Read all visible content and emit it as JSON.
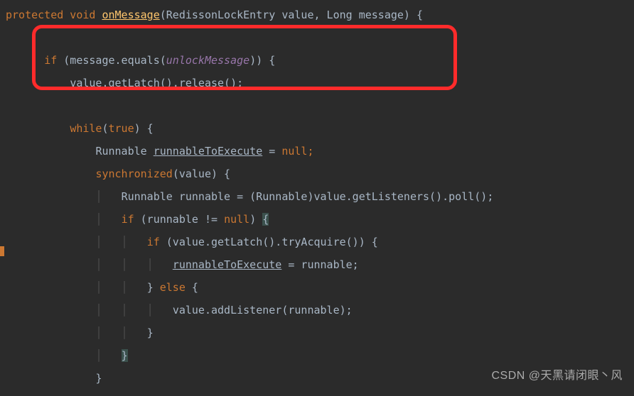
{
  "code": {
    "sig_mods": "protected void ",
    "sig_name": "onMessage",
    "sig_params_open": "(RedissonLockEntry value, Long message) {",
    "l02_if": "if ",
    "l02_open": "(message.equals(",
    "l02_arg": "unlockMessage",
    "l02_close": ")) {",
    "l03": "value.getLatch().release();",
    "l06_while": "while",
    "l06_open": "(",
    "l06_true": "true",
    "l06_close": ") {",
    "l07_a": "Runnable ",
    "l07_b": "runnableToExecute",
    "l07_c": " = ",
    "l07_null": "null",
    "l07_semi": ";",
    "l08_sync": "synchronized",
    "l08_rest": "(value) {",
    "l09": "Runnable runnable = (Runnable)value.getListeners().poll();",
    "l10_if": "if ",
    "l10_open": "(runnable != ",
    "l10_null": "null",
    "l10_close": ") ",
    "l10_brace": "{",
    "l11_if": "if ",
    "l11_rest": "(value.getLatch().tryAcquire()) {",
    "l12_a": "runnableToExecute",
    "l12_b": " = runnable;",
    "l13_close": "} ",
    "l13_else": "else ",
    "l13_open": "{",
    "l14": "value.addListener(runnable);",
    "l15": "}",
    "l16": "}",
    "l17": "}"
  },
  "watermark": "CSDN @天黑请闭眼丶风"
}
